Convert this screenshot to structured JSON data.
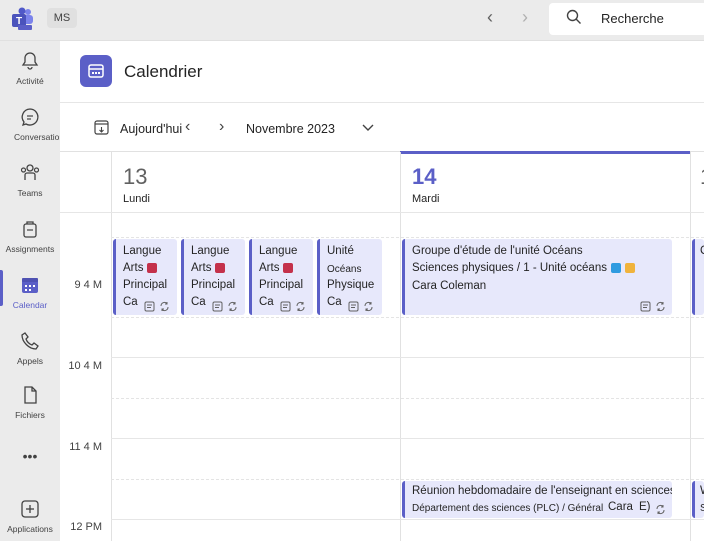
{
  "topbar": {
    "user_initials": "MS",
    "search_placeholder": "Recherche"
  },
  "rail": {
    "items": [
      {
        "label": "Activité",
        "icon": "bell-icon"
      },
      {
        "label": "Conversation",
        "icon": "chat-icon"
      },
      {
        "label": "Teams",
        "icon": "teams-icon"
      },
      {
        "label": "Assignments",
        "icon": "assignments-icon"
      },
      {
        "label": "Calendar",
        "icon": "calendar-icon",
        "active": true
      },
      {
        "label": "Appels",
        "icon": "phone-icon"
      },
      {
        "label": "Fichiers",
        "icon": "file-icon"
      },
      {
        "label": "•••",
        "icon": "more-icon"
      },
      {
        "label": "Applications",
        "icon": "add-apps-icon"
      }
    ]
  },
  "header": {
    "title": "Calendrier"
  },
  "toolbar": {
    "today_label": "Aujourd'hui",
    "month_label": "Novembre 2023"
  },
  "days": [
    {
      "number": "13",
      "name": "Lundi"
    },
    {
      "number": "14",
      "name": "Mardi",
      "today": true
    }
  ],
  "hours": [
    "9 4 M",
    "10 4 M",
    "11 4 M",
    "12 PM"
  ],
  "events": {
    "e1": {
      "l1": "Langue",
      "l2": "Arts",
      "l3": "Principal",
      "l4": "Ca"
    },
    "e2": {
      "l1": "Langue",
      "l2": "Arts",
      "l3": "Principal",
      "l4": "Ca"
    },
    "e3": {
      "l1": "Langue",
      "l2": "Arts",
      "l3": "Principal",
      "l4": "Ca"
    },
    "e4": {
      "l1": "Unité",
      "l2": "Océans",
      "l3": "Physique",
      "l4": "Ca"
    },
    "e5": {
      "l1": "Groupe d'étude de l'unité Océans",
      "l2": "Sciences physiques / 1 - Unité océans",
      "l3": "Cara Coleman"
    },
    "e6": {
      "l1": "Réunion hebdomadaire de l'enseignant en sciences",
      "l2": "Département des sciences (PLC) / Général",
      "l3": "Cara",
      "l4": "E)"
    },
    "e7": {
      "l1": "C"
    },
    "e8": {
      "l1": "W",
      "l2": "S"
    }
  },
  "colors": {
    "accent": "#5b5fc7",
    "event_bg": "#e7e8fb",
    "book_red": "#c4314b"
  }
}
